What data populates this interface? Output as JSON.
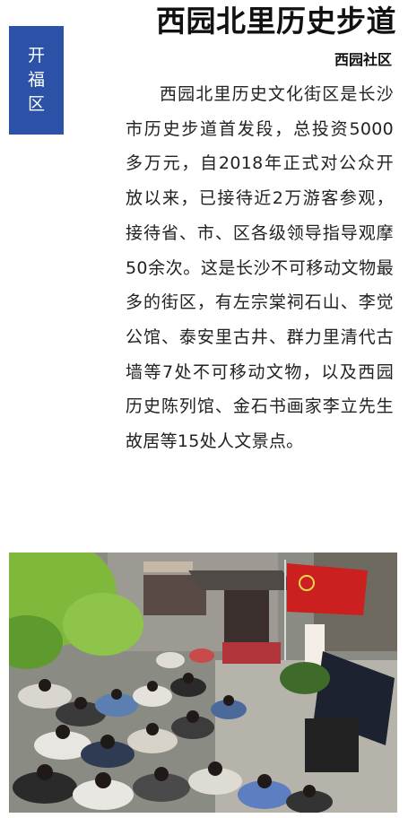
{
  "district_tag": {
    "label": "开福区"
  },
  "article": {
    "title": "西园北里历史步道",
    "source": "西园社区",
    "body": "西园北里历史文化街区是长沙市历史步道首发段，总投资5000多万元，自2018年正式对公众开放以来，已接待近2万游客参观，接待省、市、区各级领导指导观摩50余次。这是长沙不可移动文物最多的街区，有左宗棠祠石山、李觉公馆、泰安里古井、群力里清代古墙等7处不可移动文物，以及西园历史陈列馆、金石书画家李立先生故居等15处人文景点。"
  },
  "photo": {
    "flag_emblem": "hammer-and-sickle",
    "colors": {
      "tag_blue": "#2b52a6",
      "flag_red": "#cc1f1f",
      "foliage_green": "#7fb83a"
    }
  }
}
